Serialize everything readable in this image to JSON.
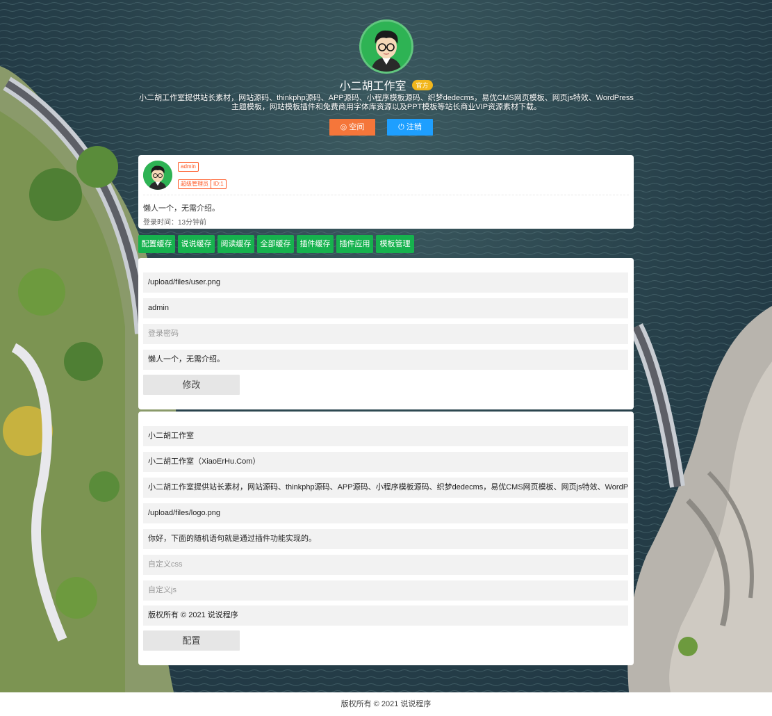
{
  "header": {
    "title": "小二胡工作室",
    "badge": "官方",
    "description": "小二胡工作室提供站长素材，网站源码、thinkphp源码、APP源码、小程序模板源码、织梦dedecms，易优CMS网页模板、网页js特效、WordPress主题模板，网站模板插件和免费商用字体库资源以及PPT模板等站长商业VIP资源素材下载。",
    "space_button": "空间",
    "logout_button": "注销"
  },
  "profile": {
    "username": "admin",
    "role": "超级管理员",
    "id": "ID:1",
    "bio": "懒人一个，无需介绍。",
    "login_time": "登录时间：13分钟前"
  },
  "cache_buttons": [
    "配置缓存",
    "说说缓存",
    "阅读缓存",
    "全部缓存",
    "插件缓存",
    "插件应用",
    "模板管理"
  ],
  "user_form": {
    "avatar_value": "/upload/files/user.png",
    "name_value": "admin",
    "password_placeholder": "登录密码",
    "bio_value": "懒人一个，无需介绍。",
    "submit": "修改"
  },
  "config_form": {
    "site_name": "小二胡工作室",
    "site_title": "小二胡工作室（XiaoErHu.Com）",
    "site_desc": "小二胡工作室提供站长素材，网站源码、thinkphp源码、APP源码、小程序模板源码、织梦dedecms，易优CMS网页模板、网页js特效、WordPress主题模板",
    "logo_value": "/upload/files/logo.png",
    "notice_value": "你好，下面的随机语句就是通过插件功能实现的。",
    "css_placeholder": "自定义css",
    "js_placeholder": "自定义js",
    "copyright_value": "版权所有 © 2021 说说程序",
    "submit": "配置"
  },
  "footer": {
    "text": "版权所有 © 2021 说说程序"
  },
  "colors": {
    "space_button": "#f5763a",
    "logout_button": "#1e9fff",
    "cache_button": "#16b24e",
    "tag": "#ff5722",
    "badge": "#f2b61c"
  },
  "icons": {
    "space": "compass-icon",
    "logout": "power-icon"
  }
}
